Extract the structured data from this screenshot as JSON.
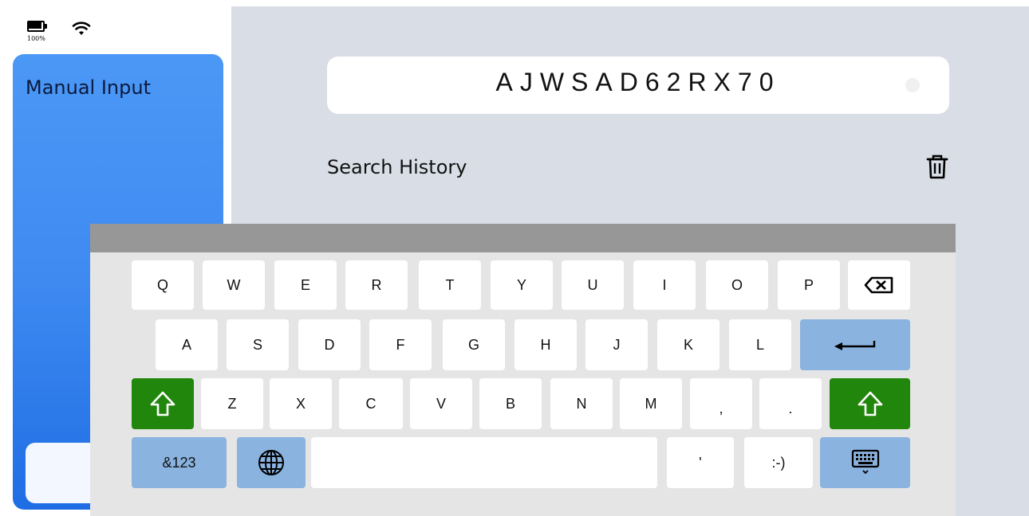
{
  "status": {
    "battery_percent": "100%"
  },
  "sidebar": {
    "title": "Manual Input"
  },
  "search": {
    "value": "AJWSAD62RX70"
  },
  "history": {
    "label": "Search History"
  },
  "keyboard": {
    "row1": [
      "Q",
      "W",
      "E",
      "R",
      "T",
      "Y",
      "U",
      "I",
      "O",
      "P"
    ],
    "row2": [
      "A",
      "S",
      "D",
      "F",
      "G",
      "H",
      "J",
      "K",
      "L"
    ],
    "row3": [
      "Z",
      "X",
      "C",
      "V",
      "B",
      "N",
      "M",
      ",",
      "."
    ],
    "row4": {
      "symbols": "&123",
      "apostrophe": "'",
      "smiley": ":-)"
    }
  },
  "colors": {
    "shift": "#20860c",
    "special": "#8ab3e0",
    "menu_card": "#3e8af1"
  }
}
